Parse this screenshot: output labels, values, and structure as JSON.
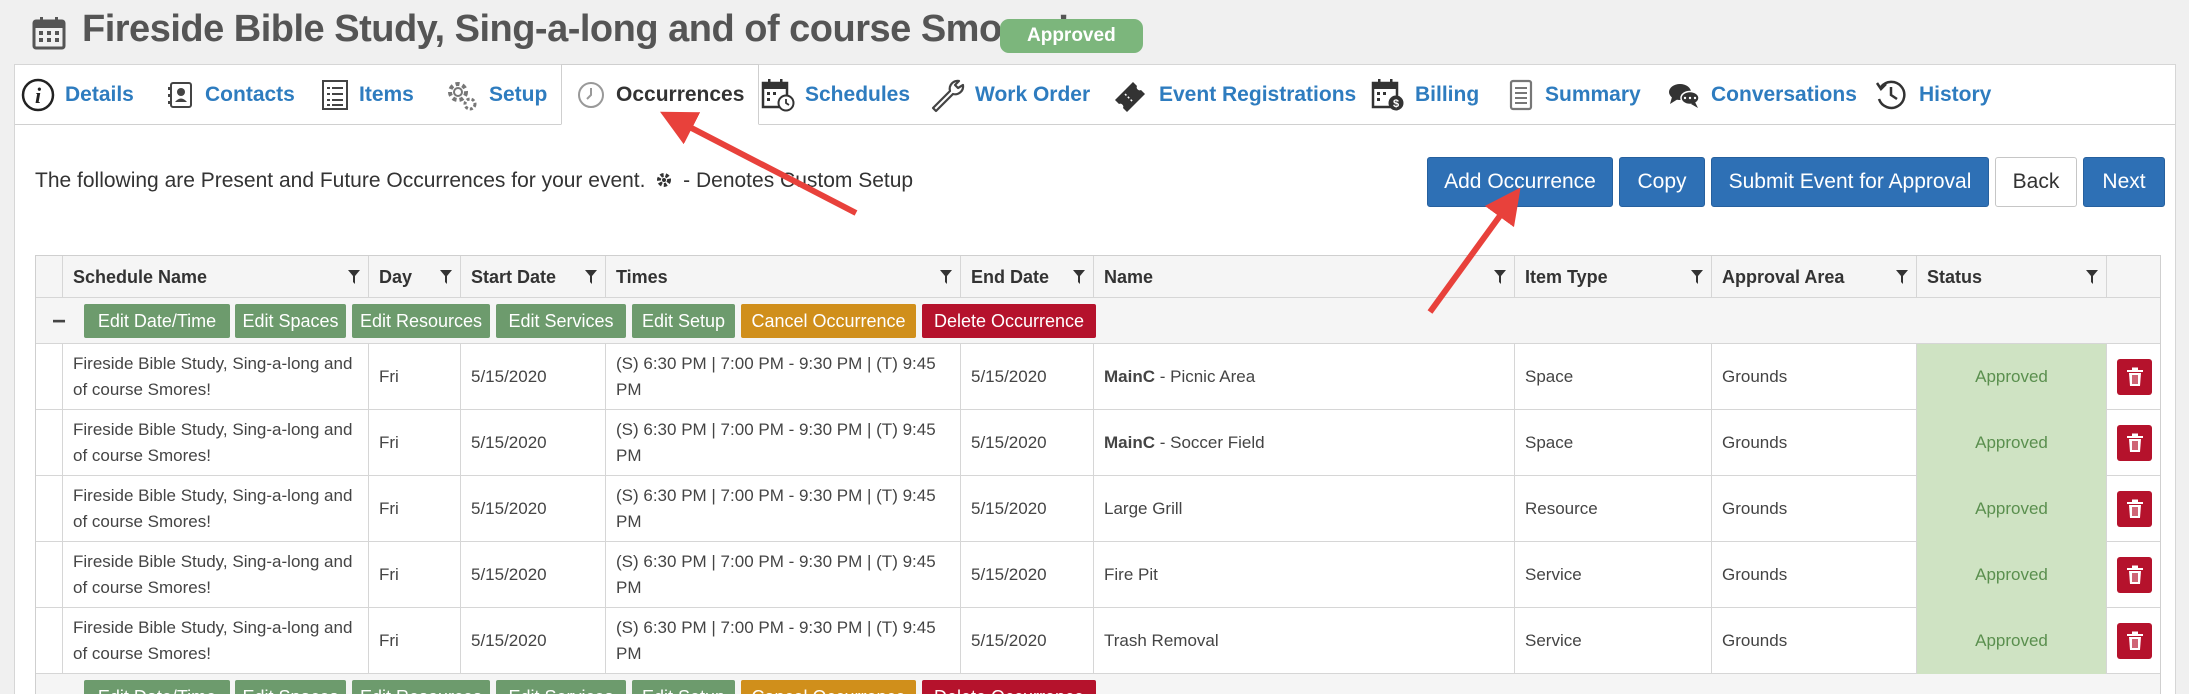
{
  "header": {
    "title": "Fireside Bible Study, Sing-a-long and of course Smores!",
    "badge": "Approved"
  },
  "tabs": [
    {
      "label": "Details",
      "icon": "info-icon"
    },
    {
      "label": "Contacts",
      "icon": "contacts-icon"
    },
    {
      "label": "Items",
      "icon": "list-icon"
    },
    {
      "label": "Setup",
      "icon": "gear-icon"
    },
    {
      "label": "Occurrences",
      "icon": "clock-icon",
      "active": true
    },
    {
      "label": "Schedules",
      "icon": "calendar-clock-icon"
    },
    {
      "label": "Work Order",
      "icon": "wrench-icon"
    },
    {
      "label": "Event Registrations",
      "icon": "ticket-icon"
    },
    {
      "label": "Billing",
      "icon": "calendar-dollar-icon"
    },
    {
      "label": "Summary",
      "icon": "document-icon"
    },
    {
      "label": "Conversations",
      "icon": "chat-icon"
    },
    {
      "label": "History",
      "icon": "history-icon"
    }
  ],
  "info": {
    "text_before": "The following are Present and Future Occurrences for your event.",
    "text_after": "- Denotes Custom Setup"
  },
  "actions": {
    "add_occurrence": "Add Occurrence",
    "copy": "Copy",
    "submit": "Submit Event for Approval",
    "back": "Back",
    "next": "Next"
  },
  "columns": [
    "Schedule Name",
    "Day",
    "Start Date",
    "Times",
    "End Date",
    "Name",
    "Item Type",
    "Approval Area",
    "Status"
  ],
  "group_actions": {
    "edit_datetime": "Edit Date/Time",
    "edit_spaces": "Edit Spaces",
    "edit_resources": "Edit Resources",
    "edit_services": "Edit Services",
    "edit_setup": "Edit Setup",
    "cancel": "Cancel Occurrence",
    "delete": "Delete Occurrence"
  },
  "rows": [
    {
      "schedule": "Fireside Bible Study, Sing-a-long and of course Smores!",
      "day": "Fri",
      "start": "5/15/2020",
      "times": "(S) 6:30 PM | 7:00 PM - 9:30 PM | (T) 9:45 PM",
      "end": "5/15/2020",
      "name_prefix": "MainC",
      "name": " - Picnic Area",
      "type": "Space",
      "area": "Grounds",
      "status": "Approved"
    },
    {
      "schedule": "Fireside Bible Study, Sing-a-long and of course Smores!",
      "day": "Fri",
      "start": "5/15/2020",
      "times": "(S) 6:30 PM | 7:00 PM - 9:30 PM | (T) 9:45 PM",
      "end": "5/15/2020",
      "name_prefix": "MainC",
      "name": " - Soccer Field",
      "type": "Space",
      "area": "Grounds",
      "status": "Approved"
    },
    {
      "schedule": "Fireside Bible Study, Sing-a-long and of course Smores!",
      "day": "Fri",
      "start": "5/15/2020",
      "times": "(S) 6:30 PM | 7:00 PM - 9:30 PM | (T) 9:45 PM",
      "end": "5/15/2020",
      "name_prefix": "",
      "name": "Large Grill",
      "type": "Resource",
      "area": "Grounds",
      "status": "Approved"
    },
    {
      "schedule": "Fireside Bible Study, Sing-a-long and of course Smores!",
      "day": "Fri",
      "start": "5/15/2020",
      "times": "(S) 6:30 PM | 7:00 PM - 9:30 PM | (T) 9:45 PM",
      "end": "5/15/2020",
      "name_prefix": "",
      "name": "Fire Pit",
      "type": "Service",
      "area": "Grounds",
      "status": "Approved"
    },
    {
      "schedule": "Fireside Bible Study, Sing-a-long and of course Smores!",
      "day": "Fri",
      "start": "5/15/2020",
      "times": "(S) 6:30 PM | 7:00 PM - 9:30 PM | (T) 9:45 PM",
      "end": "5/15/2020",
      "name_prefix": "",
      "name": "Trash Removal",
      "type": "Service",
      "area": "Grounds",
      "status": "Approved"
    }
  ],
  "colors": {
    "link": "#2e7cbf",
    "primary": "#2e70b5",
    "approved_bg": "#cfe3c3",
    "approved_text": "#5a8f4e",
    "badge": "#7cb67c",
    "edit_green": "#6d9b6d",
    "cancel_orange": "#d08f1b",
    "delete_red": "#b5122c",
    "annotation_arrow": "#e8413b"
  }
}
